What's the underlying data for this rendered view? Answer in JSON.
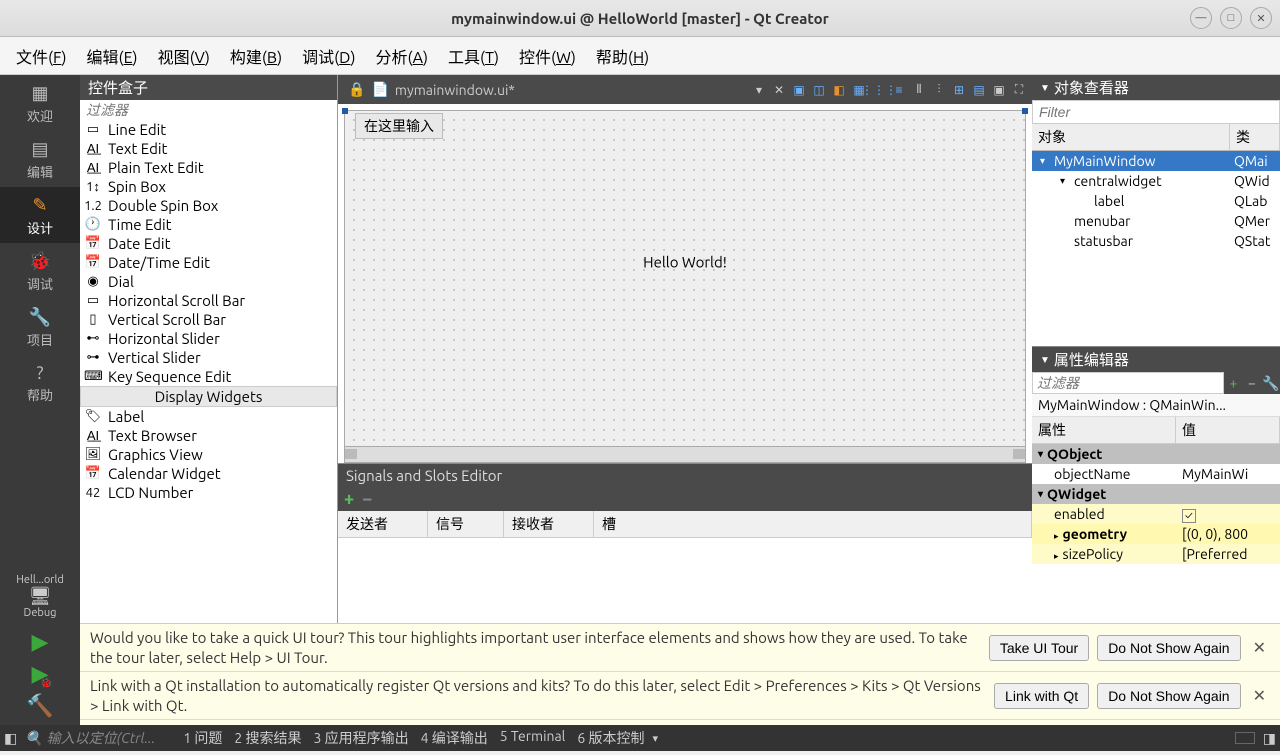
{
  "window": {
    "title": "mymainwindow.ui @ HelloWorld [master] - Qt Creator"
  },
  "menubar": {
    "items": [
      "文件(F)",
      "编辑(E)",
      "视图(V)",
      "构建(B)",
      "调试(D)",
      "分析(A)",
      "工具(T)",
      "控件(W)",
      "帮助(H)"
    ]
  },
  "sidebar": {
    "welcome": "欢迎",
    "edit": "编辑",
    "design": "设计",
    "debug": "调试",
    "projects": "项目",
    "help": "帮助",
    "target": "Hell...orld",
    "config": "Debug"
  },
  "widgetbox": {
    "title": "控件盒子",
    "filter_placeholder": "过滤器",
    "items_top": [
      "Line Edit",
      "Text Edit",
      "Plain Text Edit",
      "Spin Box",
      "Double Spin Box",
      "Time Edit",
      "Date Edit",
      "Date/Time Edit",
      "Dial",
      "Horizontal Scroll Bar",
      "Vertical Scroll Bar",
      "Horizontal Slider",
      "Vertical Slider",
      "Key Sequence Edit"
    ],
    "group": "Display Widgets",
    "items_bottom": [
      "Label",
      "Text Browser",
      "Graphics View",
      "Calendar Widget",
      "LCD Number"
    ]
  },
  "design": {
    "tab_label": "mymainwindow.ui*",
    "form_hint": "在这里输入",
    "label_text": "Hello World!"
  },
  "signals": {
    "title": "Signals and Slots Editor",
    "headers": {
      "sender": "发送者",
      "signal": "信号",
      "receiver": "接收者",
      "slot": "槽"
    }
  },
  "object_inspector": {
    "title": "对象查看器",
    "filter_placeholder": "Filter",
    "headers": {
      "object": "对象",
      "class": "类"
    },
    "tree": [
      {
        "name": "MyMainWindow",
        "class": "QMai",
        "depth": 0,
        "selected": true,
        "expandable": true
      },
      {
        "name": "centralwidget",
        "class": "QWid",
        "depth": 1,
        "expandable": true
      },
      {
        "name": "label",
        "class": "QLab",
        "depth": 2
      },
      {
        "name": "menubar",
        "class": "QMer",
        "depth": 1
      },
      {
        "name": "statusbar",
        "class": "QStat",
        "depth": 1
      }
    ]
  },
  "property_editor": {
    "title": "属性编辑器",
    "filter_placeholder": "过滤器",
    "path": "MyMainWindow : QMainWin...",
    "headers": {
      "property": "属性",
      "value": "值"
    },
    "groups": [
      {
        "name": "QObject",
        "rows": [
          {
            "name": "objectName",
            "value": "MyMainWi"
          }
        ]
      },
      {
        "name": "QWidget",
        "rows": [
          {
            "name": "enabled",
            "value": "✓",
            "checkbox": true
          },
          {
            "name": "geometry",
            "value": "[(0, 0), 800",
            "bold": true,
            "expandable": true
          },
          {
            "name": "sizePolicy",
            "value": "[Preferred",
            "expandable": true
          }
        ]
      }
    ]
  },
  "notifications": [
    {
      "text": "Would you like to take a quick UI tour? This tour highlights important user interface elements and shows how they are used. To take the tour later, select Help > UI Tour.",
      "primary": "Take UI Tour",
      "secondary": "Do Not Show Again"
    },
    {
      "text": "Link with a Qt installation to automatically register Qt versions and kits? To do this later, select Edit > Preferences > Kits > Qt Versions > Link with Qt.",
      "primary": "Link with Qt",
      "secondary": "Do Not Show Again"
    }
  ],
  "statusbar": {
    "locate_placeholder": "输入以定位(Ctrl...",
    "tabs": [
      "1 问题",
      "2 搜索结果",
      "3 应用程序输出",
      "4 编译输出",
      "5 Terminal",
      "6 版本控制"
    ]
  }
}
